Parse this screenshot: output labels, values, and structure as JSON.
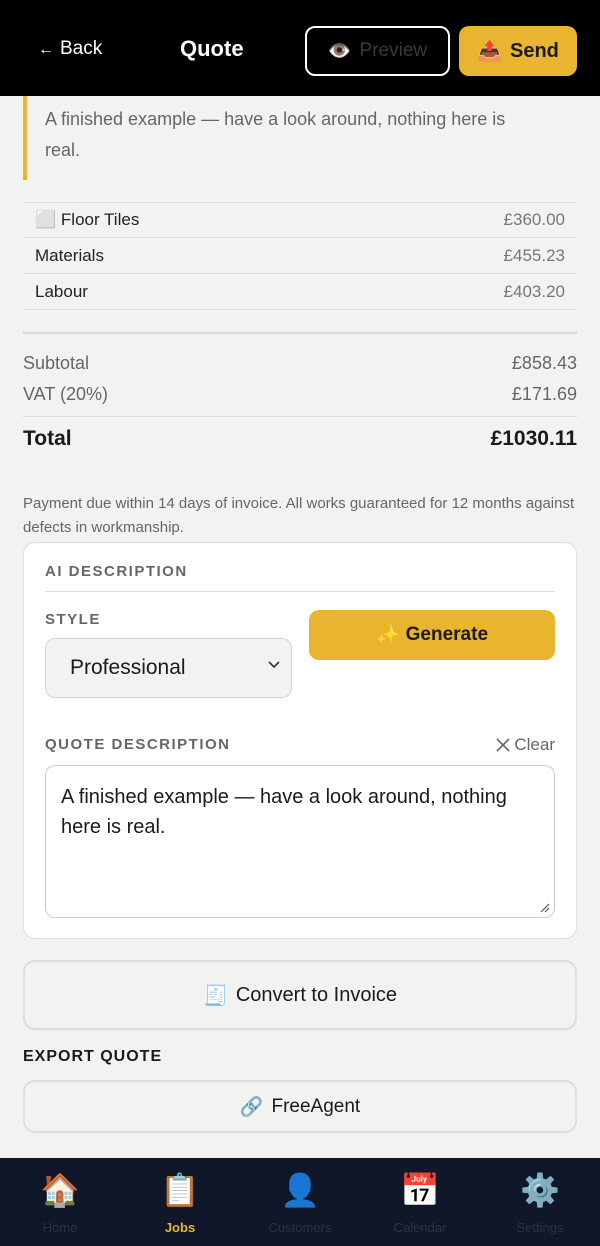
{
  "header": {
    "back_label": "Back",
    "back_arrow": "←",
    "title": "Quote",
    "preview_icon": "👁️",
    "preview_label": "Preview",
    "send_icon": "📤",
    "send_label": "Send"
  },
  "note": "A finished example — have a look around, nothing here is real.",
  "line_items": [
    {
      "icon": "⬜",
      "name": "Floor Tiles",
      "amount": "£360.00"
    },
    {
      "icon": "",
      "name": "Materials",
      "amount": "£455.23"
    },
    {
      "icon": "",
      "name": "Labour",
      "amount": "£403.20"
    }
  ],
  "totals": {
    "subtotal_label": "Subtotal",
    "subtotal": "£858.43",
    "vat_label": "VAT (20%)",
    "vat": "£171.69",
    "total_label": "Total",
    "total": "£1030.11"
  },
  "terms": "Payment due within 14 days of invoice. All works guaranteed for 12 months against defects in workmanship.",
  "ai": {
    "heading": "AI DESCRIPTION",
    "style_label": "STYLE",
    "style_value": "Professional",
    "generate_icon": "✨",
    "generate_label": "Generate",
    "desc_label": "QUOTE DESCRIPTION",
    "clear_label": "Clear",
    "description": "A finished example — have a look around, nothing here is real."
  },
  "convert": {
    "icon": "🧾",
    "label": "Convert to Invoice"
  },
  "export": {
    "title": "EXPORT QUOTE",
    "freeagent_icon": "🔗",
    "freeagent_label": "FreeAgent"
  },
  "nav": [
    {
      "icon": "🏠",
      "label": "Home",
      "active": false
    },
    {
      "icon": "📋",
      "label": "Jobs",
      "active": true
    },
    {
      "icon": "👤",
      "label": "Customers",
      "active": false
    },
    {
      "icon": "📅",
      "label": "Calendar",
      "active": false
    },
    {
      "icon": "⚙️",
      "label": "Settings",
      "active": false
    }
  ],
  "colors": {
    "accent": "#e9b430",
    "header_bg": "#000000",
    "nav_bg": "#0f1729"
  }
}
